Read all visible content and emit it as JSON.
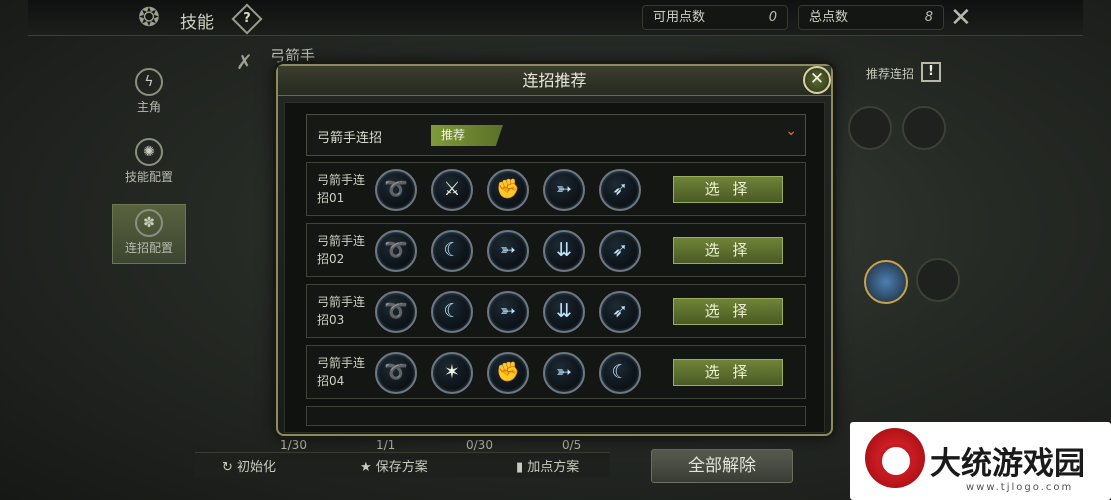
{
  "header": {
    "title": "技能",
    "help_label": "?",
    "available_points_label": "可用点数",
    "available_points_value": "0",
    "total_points_label": "总点数",
    "total_points_value": "8"
  },
  "sidebar": {
    "items": [
      {
        "label": "主角"
      },
      {
        "label": "技能配置"
      },
      {
        "label": "连招配置"
      }
    ]
  },
  "main": {
    "class_name": "弓箭手",
    "recommend_combo_label": "推荐连招",
    "recommend_icon": "!",
    "counters": [
      "1/30",
      "1/1",
      "0/30",
      "0/5"
    ],
    "bottom_buttons": [
      "初始化",
      "保存方案",
      "加点方案"
    ],
    "reset_all_label": "全部解除"
  },
  "modal": {
    "title": "连招推荐",
    "close_label": "✕",
    "selector": {
      "label": "弓箭手连招",
      "tag": "推荐"
    },
    "select_label": "选 择",
    "combos": [
      {
        "name_line1": "弓箭手连",
        "name_line2": "招01",
        "skills": [
          "swirl-icon",
          "crossed-swords-icon",
          "fist-icon",
          "arrow-shot-icon",
          "arrow-diagonal-icon"
        ]
      },
      {
        "name_line1": "弓箭手连",
        "name_line2": "招02",
        "skills": [
          "swirl-icon",
          "bow-icon",
          "arrow-shot-icon",
          "arrow-rain-icon",
          "arrow-diagonal-icon"
        ]
      },
      {
        "name_line1": "弓箭手连",
        "name_line2": "招03",
        "skills": [
          "swirl-icon",
          "bow-icon",
          "arrow-shot-icon",
          "arrow-rain-icon",
          "arrow-diagonal-icon"
        ]
      },
      {
        "name_line1": "弓箭手连",
        "name_line2": "招04",
        "skills": [
          "swirl-icon",
          "dodge-figure-icon",
          "fist-icon",
          "arrow-shot-icon",
          "bow-icon"
        ]
      }
    ]
  },
  "watermark": {
    "text": "大统游戏园",
    "url": "www.tjlogo.com"
  }
}
